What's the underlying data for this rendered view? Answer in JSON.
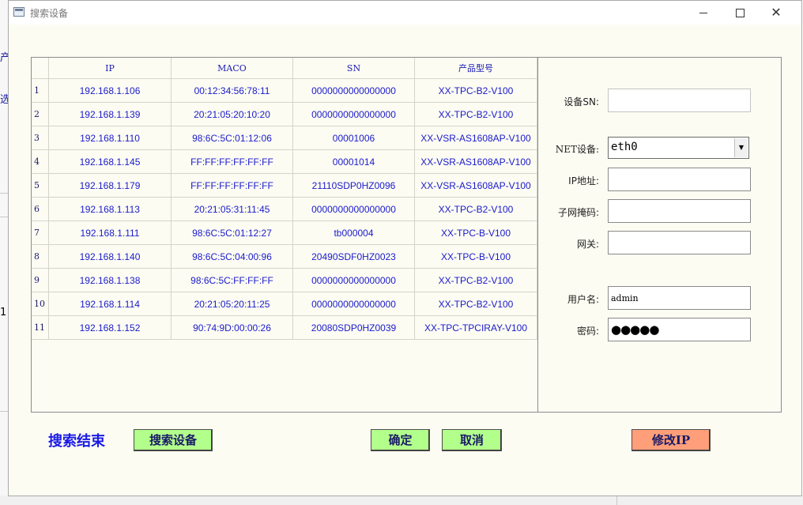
{
  "window": {
    "title": "搜索设备"
  },
  "background": {
    "glyphs": [
      "产",
      "选",
      "1"
    ]
  },
  "table": {
    "headers": [
      "IP",
      "MACO",
      "SN",
      "产品型号"
    ],
    "rows": [
      {
        "n": "1",
        "ip": "192.168.1.106",
        "mac": "00:12:34:56:78:11",
        "sn": "0000000000000000",
        "model": "XX-TPC-B2-V100"
      },
      {
        "n": "2",
        "ip": "192.168.1.139",
        "mac": "20:21:05:20:10:20",
        "sn": "0000000000000000",
        "model": "XX-TPC-B2-V100"
      },
      {
        "n": "3",
        "ip": "192.168.1.110",
        "mac": "98:6C:5C:01:12:06",
        "sn": "00001006",
        "model": "XX-VSR-AS1608AP-V100"
      },
      {
        "n": "4",
        "ip": "192.168.1.145",
        "mac": "FF:FF:FF:FF:FF:FF",
        "sn": "00001014",
        "model": "XX-VSR-AS1608AP-V100"
      },
      {
        "n": "5",
        "ip": "192.168.1.179",
        "mac": "FF:FF:FF:FF:FF:FF",
        "sn": "21110SDP0HZ0096",
        "model": "XX-VSR-AS1608AP-V100"
      },
      {
        "n": "6",
        "ip": "192.168.1.113",
        "mac": "20:21:05:31:11:45",
        "sn": "0000000000000000",
        "model": "XX-TPC-B2-V100"
      },
      {
        "n": "7",
        "ip": "192.168.1.111",
        "mac": "98:6C:5C:01:12:27",
        "sn": "tb000004",
        "model": "XX-TPC-B-V100"
      },
      {
        "n": "8",
        "ip": "192.168.1.140",
        "mac": "98:6C:5C:04:00:96",
        "sn": "20490SDF0HZ0023",
        "model": "XX-TPC-B-V100"
      },
      {
        "n": "9",
        "ip": "192.168.1.138",
        "mac": "98:6C:5C:FF:FF:FF",
        "sn": "0000000000000000",
        "model": "XX-TPC-B2-V100"
      },
      {
        "n": "10",
        "ip": "192.168.1.114",
        "mac": "20:21:05:20:11:25",
        "sn": "0000000000000000",
        "model": "XX-TPC-B2-V100"
      },
      {
        "n": "11",
        "ip": "192.168.1.152",
        "mac": "90:74:9D:00:00:26",
        "sn": "20080SDP0HZ0039",
        "model": "XX-TPC-TPCIRAY-V100"
      }
    ]
  },
  "form": {
    "sn_label": "设备SN:",
    "sn_value": "",
    "net_label": "NET设备:",
    "net_value": "eth0",
    "ip_label": "IP地址:",
    "ip_value": "",
    "mask_label": "子网掩码:",
    "mask_value": "",
    "gateway_label": "网关:",
    "gateway_value": "",
    "user_label": "用户名:",
    "user_value": "admin",
    "password_label": "密码:",
    "password_value": "●●●●●"
  },
  "footer": {
    "status": "搜索结束",
    "search_label": "搜索设备",
    "ok_label": "确定",
    "cancel_label": "取消",
    "modify_label": "修改IP"
  },
  "colors": {
    "window_bg": "#fcfcf3",
    "table_text": "#1a1acc",
    "status_text": "#1a1ae6",
    "green_button": "#b3ff8c",
    "orange_button": "#ff9f7a"
  }
}
